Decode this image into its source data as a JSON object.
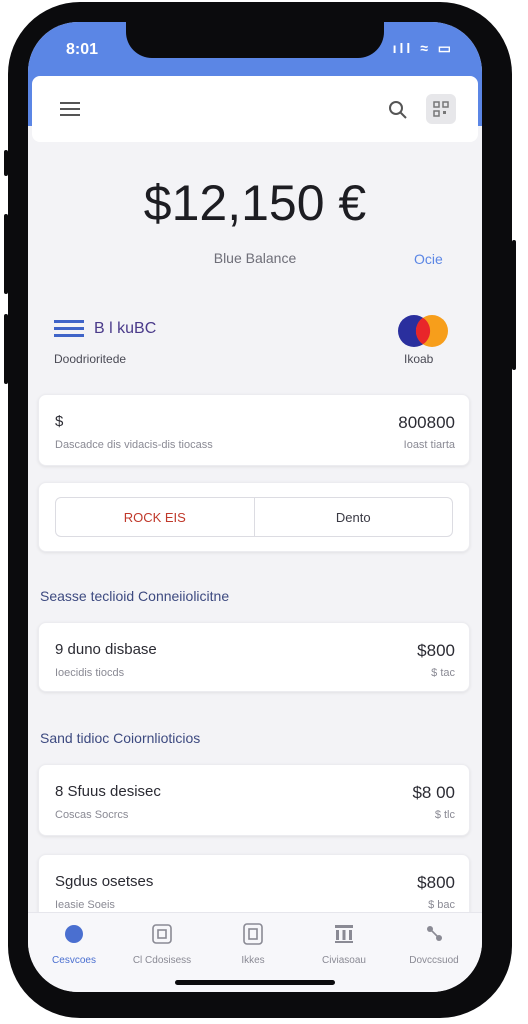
{
  "status_bar": {
    "time": "8:01",
    "icons": "ıll ≈ ▭"
  },
  "header": {
    "menu_icon": "hamburger-icon",
    "search_icon": "search-icon",
    "qr_icon": "qr-code-icon"
  },
  "balance": {
    "amount": "$12,150 €",
    "label": "Blue Balance",
    "link": "Ocie"
  },
  "card": {
    "name": "B l kuBC",
    "number": "Doodrioritede",
    "brand_label": "Ikoab"
  },
  "summary_card": {
    "title": "$",
    "subtitle": "Dascadce dis vidacis-dis tiocass",
    "amount": "800800",
    "sub": "Ioast tiarta"
  },
  "segment": {
    "left": "ROCK EIS",
    "right": "Dento"
  },
  "section1": {
    "title": "Seasse teclioid Conneiiolicitne",
    "items": [
      {
        "title": "9 duno disbase",
        "subtitle": "Ioecidis tiocds",
        "amount": "$800",
        "sub": "$ tac"
      }
    ]
  },
  "section2": {
    "title": "Sand tidioc Coiornlioticios",
    "items": [
      {
        "title": "8 Sfuus desisec",
        "subtitle": "Coscas Socrcs",
        "amount": "$8 00",
        "sub": "$ tlc"
      },
      {
        "title": "Sgdus osetses",
        "subtitle": "Ieasie Soeis",
        "amount": "$800",
        "sub": "$ bac"
      }
    ]
  },
  "tabbar": [
    {
      "label": "Cesvcoes",
      "icon": "home-icon"
    },
    {
      "label": "Cl Cdosisess",
      "icon": "card-icon"
    },
    {
      "label": "Ikkes",
      "icon": "wallet-icon"
    },
    {
      "label": "Civiasoau",
      "icon": "bank-icon"
    },
    {
      "label": "Dovccsuod",
      "icon": "settings-icon"
    }
  ],
  "colors": {
    "accent": "#5b86e5",
    "mc_red": "#e8262a",
    "mc_orange": "#f79e1b",
    "mc_blue": "#2a2f9e"
  }
}
